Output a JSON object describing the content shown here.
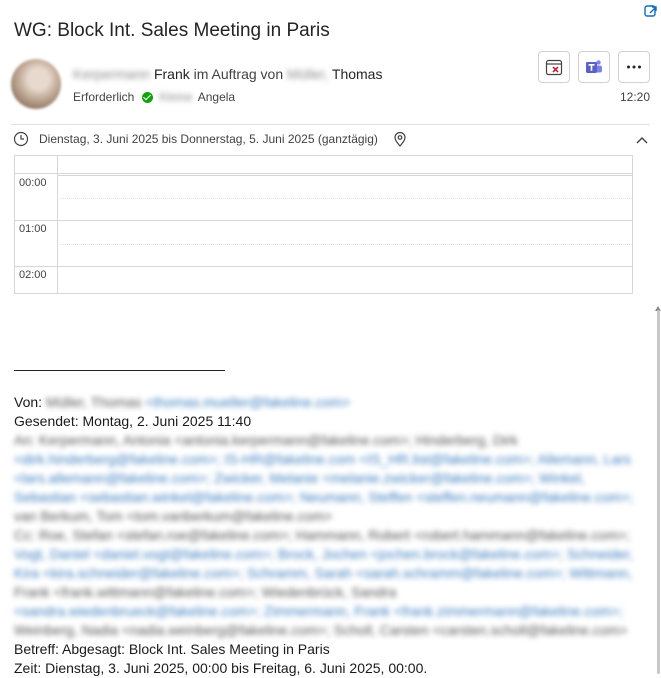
{
  "message": {
    "subject": "WG: Block Int. Sales Meeting in Paris",
    "sender_redacted": "Kerpermann",
    "sender_first": "Frank",
    "on_behalf_text": "im Auftrag von",
    "delegate_redacted": "Müller,",
    "delegate_first": "Thomas",
    "required_label": "Erforderlich",
    "attendee_redacted": "Kleine",
    "attendee_first": "Angela",
    "time": "12:20",
    "date_range": "Dienstag, 3. Juni 2025 bis Donnerstag, 5. Juni 2025 (ganztägig)"
  },
  "calendar": {
    "hours": [
      "00:00",
      "01:00",
      "02:00"
    ]
  },
  "body": {
    "von_label": "Von:",
    "von_name_redacted": "Müller, Thomas",
    "von_email_redacted": "<thomas.mueller@fakeline.com>",
    "gesendet": "Gesendet: Montag, 2. Juni 2025 11:40",
    "recipients_redacted": [
      "An: Kerpermann, Antonia <antonia.kerpermann@fakeline.com>; Hinderberg, Dirk",
      "<dirk.hinderberg@fakeline.com>; IS-HR@fakeline.com <IS_HR.list@fakeline.com>; Allemann, Lars",
      "<lars.allemann@fakeline.com>; Zwicker, Melanie <melanie.zwicker@fakeline.com>; Winkel,",
      "Sebastian <sebastian.winkel@fakeline.com>; Neumann, Steffen <steffen.neumann@fakeline.com>;",
      "van Berkum, Tom <tom.vanberkum@fakeline.com>",
      "Cc: Roe, Stefan <stefan.roe@fakeline.com>; Hammann, Robert <robert.hammann@fakeline.com>;",
      "Vogt, Daniel <daniel.vogt@fakeline.com>; Brock, Jochen <jochen.brock@fakeline.com>; Schneider,",
      "Kira <kira.schneider@fakeline.com>; Schramm, Sarah <sarah.schramm@fakeline.com>; Wittmann,",
      "Frank <frank.wittmann@fakeline.com>; Wiedenbrück, Sandra",
      "<sandra.wiedenbrueck@fakeline.com>; Zimmermann, Frank <frank.zimmermann@fakeline.com>;",
      "Weinberg, Nadia <nadia.weinberg@fakeline.com>; Scholl, Carsten <carsten.scholl@fakeline.com>"
    ],
    "betreff": "Betreff: Abgesagt: Block Int. Sales Meeting in Paris",
    "zeit": "Zeit: Dienstag, 3. Juni 2025, 00:00 bis Freitag, 6. Juni 2025, 00:00."
  },
  "icons": {
    "cancel_calendar": "calendar-cancel-icon",
    "teams": "teams-icon",
    "more": "more-options-icon",
    "clock": "clock-icon",
    "location": "location-pin-icon",
    "collapse": "chevron-up-icon"
  },
  "colors": {
    "accent": "#0f6cbd",
    "teams": "#5b5fc7",
    "cancel_red": "#c50f1f",
    "accepted_green": "#13a10e",
    "link_blurred": "#3b7dc0"
  }
}
